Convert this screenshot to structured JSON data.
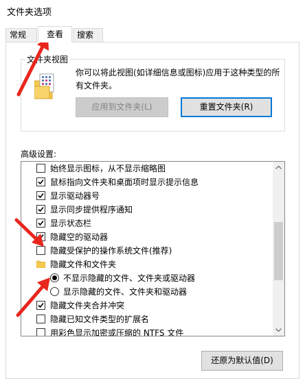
{
  "window": {
    "title": "文件夹选项"
  },
  "tabs": [
    {
      "label": "常规",
      "active": false
    },
    {
      "label": "查看",
      "active": true
    },
    {
      "label": "搜索",
      "active": false
    }
  ],
  "folder_views": {
    "group_label": "文件夹视图",
    "description": "你可以将此视图(如详细信息或图标)应用于这种类型的所有文件夹。",
    "apply_button": "应用到文件夹(L)",
    "reset_button": "重置文件夹(R)"
  },
  "advanced": {
    "label": "高级设置:",
    "items": [
      {
        "type": "checkbox",
        "checked": false,
        "label": "始终显示图标，从不显示缩略图"
      },
      {
        "type": "checkbox",
        "checked": true,
        "label": "鼠标指向文件夹和桌面项时显示提示信息"
      },
      {
        "type": "checkbox",
        "checked": true,
        "label": "显示驱动器号"
      },
      {
        "type": "checkbox",
        "checked": true,
        "label": "显示同步提供程序通知"
      },
      {
        "type": "checkbox",
        "checked": true,
        "label": "显示状态栏"
      },
      {
        "type": "checkbox",
        "checked": true,
        "label": "隐藏空的驱动器"
      },
      {
        "type": "checkbox",
        "checked": false,
        "label": "隐藏受保护的操作系统文件(推荐)"
      },
      {
        "type": "folder",
        "label": "隐藏文件和文件夹"
      },
      {
        "type": "radio",
        "checked": true,
        "label": "不显示隐藏的文件、文件夹或驱动器"
      },
      {
        "type": "radio",
        "checked": false,
        "label": "显示隐藏的文件、文件夹和驱动器"
      },
      {
        "type": "checkbox",
        "checked": true,
        "label": "隐藏文件夹合并冲突"
      },
      {
        "type": "checkbox",
        "checked": false,
        "label": "隐藏已知文件类型的扩展名"
      },
      {
        "type": "checkbox",
        "checked": false,
        "label": "用彩色显示加密或压缩的 NTFS 文件"
      }
    ]
  },
  "restore_button": "还原为默认值(D)",
  "colors": {
    "accent": "#0078d7",
    "annotation": "#e8261d",
    "folder": "#f5c94c"
  }
}
